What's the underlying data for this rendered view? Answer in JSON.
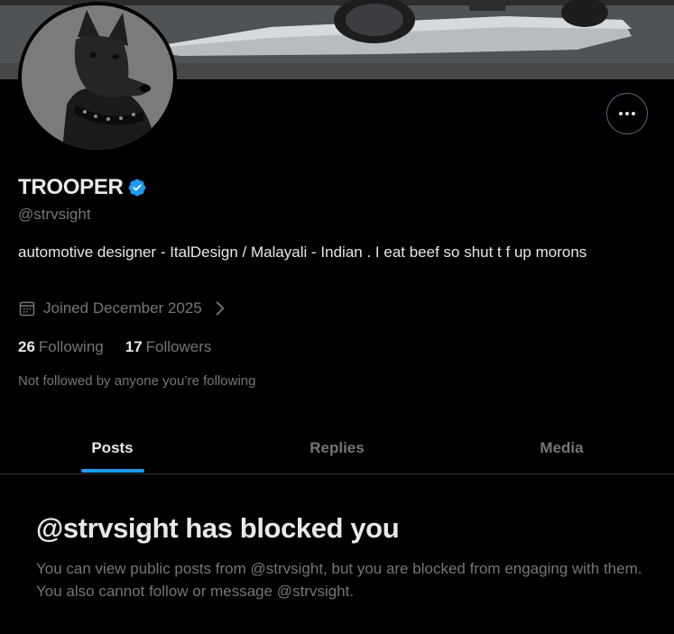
{
  "profile": {
    "display_name": "TROOPER",
    "handle": "@strvsight",
    "bio": "automotive designer - ItalDesign / Malayali - Indian . I eat beef so shut t f up morons",
    "joined": "Joined December 2025",
    "following_count": "26",
    "following_label": "Following",
    "followers_count": "17",
    "followers_label": "Followers",
    "not_followed_text": "Not followed by anyone you’re following"
  },
  "tabs": [
    {
      "label": "Posts",
      "active": true
    },
    {
      "label": "Replies",
      "active": false
    },
    {
      "label": "Media",
      "active": false
    }
  ],
  "blocked": {
    "title": "@strvsight has blocked you",
    "description": "You can view public posts from @strvsight, but you are blocked from engaging with them. You also cannot follow or message @strvsight."
  },
  "colors": {
    "background": "#000000",
    "accent": "#1d9bf0",
    "text_primary": "#e7e9ea",
    "text_secondary": "#71767b",
    "border": "#2f3336"
  },
  "icons": {
    "more": "more-horizontal-icon",
    "verified": "verified-badge-icon",
    "calendar": "calendar-icon",
    "chevron": "chevron-right-icon"
  }
}
